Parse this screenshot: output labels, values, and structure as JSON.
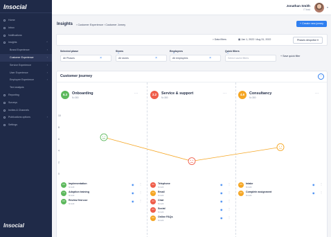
{
  "app": {
    "logo": "Insocial",
    "brand_mark": "Insocial"
  },
  "colors": {
    "green": "#5cb85c",
    "red": "#ef5d4a",
    "orange": "#f5a623",
    "accent": "#2f7ff0",
    "sidebar": "#1f2a48"
  },
  "sidebar": {
    "items": [
      {
        "label": "Home",
        "sub": false,
        "active": false,
        "chevron": ""
      },
      {
        "label": "Inbox",
        "sub": false,
        "active": false,
        "chevron": ""
      },
      {
        "label": "Notifications",
        "sub": false,
        "active": false,
        "chevron": ""
      },
      {
        "label": "Insights",
        "sub": false,
        "active": false,
        "chevron": "^"
      },
      {
        "label": "Brand Experience",
        "sub": true,
        "active": false,
        "chevron": "›"
      },
      {
        "label": "Customer Experience",
        "sub": true,
        "active": true,
        "chevron": "›"
      },
      {
        "label": "Service Experience",
        "sub": true,
        "active": false,
        "chevron": "›"
      },
      {
        "label": "User Experience",
        "sub": true,
        "active": false,
        "chevron": "›"
      },
      {
        "label": "Employee Experience",
        "sub": true,
        "active": false,
        "chevron": "›"
      },
      {
        "label": "Text analysis",
        "sub": true,
        "active": false,
        "chevron": ""
      },
      {
        "label": "Reporting",
        "sub": false,
        "active": false,
        "chevron": ""
      },
      {
        "label": "Surveys",
        "sub": false,
        "active": false,
        "chevron": ""
      },
      {
        "label": "Invites & Channels",
        "sub": false,
        "active": false,
        "chevron": ""
      },
      {
        "label": "Publications options",
        "sub": false,
        "active": false,
        "chevron": "›"
      },
      {
        "label": "Settings",
        "sub": false,
        "active": false,
        "chevron": ""
      }
    ]
  },
  "user": {
    "name": "Jonathan Smith",
    "role": "IT lead"
  },
  "header": {
    "title": "Insights",
    "breadcrumb": "›  Customer Experience  ›  Customer Jorney",
    "create_button": "+ Create new jorney"
  },
  "filters": {
    "data_filters": "▿ Data filters",
    "date_range": "▦ Jan 1, 2022 / Aug 31, 2022",
    "phases_button": "Phases despctive  ▾"
  },
  "selectors": [
    {
      "label": "Selected phase",
      "value": "All Phases",
      "placeholder": false
    },
    {
      "label": "Stores",
      "value": "All stores",
      "placeholder": false
    },
    {
      "label": "Employees",
      "value": "All employees",
      "placeholder": false
    },
    {
      "label": "Quick filters",
      "value": "Select saved filters",
      "placeholder": true
    }
  ],
  "save_quick_filter": "+ Save quick filter",
  "panel": {
    "title": "Customer journey",
    "toggle_icon": "chevron-up-icon"
  },
  "stages": [
    {
      "score": "6.3",
      "name": "Onboarding",
      "n": "N=380",
      "color": "#5cb85c"
    },
    {
      "score": "2.2",
      "name": "Service & support",
      "n": "N=380",
      "color": "#ef5d4a"
    },
    {
      "score": "4.6",
      "name": "Consultancy",
      "n": "N=380",
      "color": "#f5a623"
    }
  ],
  "chart_data": {
    "type": "line",
    "title": "",
    "xlabel": "",
    "ylabel": "",
    "categories": [
      "Onboarding",
      "Service & support",
      "Consultancy"
    ],
    "series": [
      {
        "values": [
          6.3,
          2.2,
          4.6
        ]
      }
    ],
    "ylim": [
      0,
      10
    ],
    "yticks": [
      "10",
      "8",
      "6",
      "4",
      "2",
      "0"
    ],
    "markers": [
      "smile",
      "frown",
      "neutral"
    ],
    "segment_colors": [
      "#f5a623",
      "#f5a623"
    ],
    "grid": false
  },
  "steps": [
    [
      {
        "score": "9.6",
        "name": "Implementation",
        "n": "N=123",
        "color": "#5cb85c"
      },
      {
        "score": "7.4",
        "name": "Adoption training",
        "n": "N=123",
        "color": "#5cb85c"
      },
      {
        "score": "8.8",
        "name": "Review first use",
        "n": "N=123",
        "color": "#5cb85c"
      }
    ],
    [
      {
        "score": "4.2",
        "name": "Telephone",
        "n": "N=123",
        "color": "#ef5d4a"
      },
      {
        "score": "7.2",
        "name": "Email",
        "n": "N=123",
        "color": "#f5a623"
      },
      {
        "score": "4.4",
        "name": "Chat",
        "n": "N=123",
        "color": "#ef5d4a"
      },
      {
        "score": "4.4",
        "name": "Social",
        "n": "N=123",
        "color": "#ef5d4a"
      },
      {
        "score": "6.6",
        "name": "Online FAQs",
        "n": "N=123",
        "color": "#f5a623"
      }
    ],
    [
      {
        "score": "6.5",
        "name": "Intake",
        "n": "N=123",
        "color": "#f5a623"
      },
      {
        "score": "6.6",
        "name": "Complete assignment",
        "n": "N=123",
        "color": "#f5a623"
      }
    ]
  ]
}
